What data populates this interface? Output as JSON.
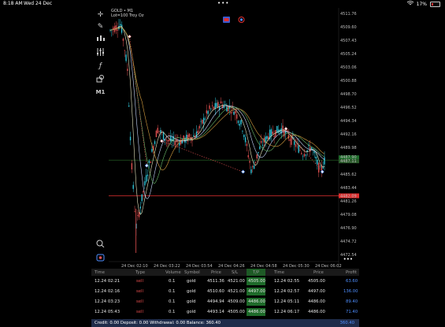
{
  "statusbar": {
    "time": "8:18 AM",
    "date": "Wed 24 Dec",
    "battery": "17%"
  },
  "chart": {
    "symbol": "GOLD • M1",
    "symbol_desc": "Lot=100 Troy Oz",
    "current_bid": "4487.90",
    "current_ask": "4487.11",
    "ref_line_price": "4482.09",
    "price_ticks": [
      "4511.76",
      "4509.60",
      "4507.43",
      "4505.24",
      "4503.06",
      "4500.88",
      "4498.70",
      "4496.52",
      "4494.34",
      "4492.16",
      "4489.98",
      "4487.80",
      "4485.62",
      "4483.44",
      "4481.26",
      "4479.08",
      "4476.90",
      "4474.72",
      "4472.54"
    ],
    "time_ticks": [
      "24 Dec 02:10",
      "24 Dec 03:22",
      "24 Dec 03:54",
      "24 Dec 04:26",
      "24 Dec 04:58",
      "24 Dec 05:30",
      "24 Dec 06:02"
    ],
    "toolbar": [
      "crosshair",
      "draw-pencil",
      "candles",
      "indicators",
      "function",
      "objects",
      "timeframe"
    ],
    "timeframe": "M1"
  },
  "colors": {
    "bull": "#2ec4d8",
    "bear": "#e05050",
    "ref_line": "#e03030",
    "green_line": "#2a6b2a",
    "tp_bg": "#1e6b2a",
    "accent": "#4f8fff"
  },
  "positions": {
    "headers": [
      "Time",
      "Type",
      "Volume",
      "Symbol",
      "Price",
      "S/L",
      "T/P",
      "Time",
      "Price",
      "Profit"
    ],
    "rows": [
      [
        "12.24 02:21",
        "sell",
        "0.1",
        "gold",
        "4511.36",
        "4521.00",
        "4505.00",
        "12.24 02:55",
        "4505.00",
        "63.60"
      ],
      [
        "12.24 02:16",
        "sell",
        "0.1",
        "gold",
        "4510.60",
        "4521.00",
        "4497.00",
        "12.24 02:57",
        "4497.00",
        "136.00"
      ],
      [
        "12.24 03:23",
        "sell",
        "0.1",
        "gold",
        "4494.94",
        "4509.00",
        "4486.00",
        "12.24 05:11",
        "4486.00",
        "89.40"
      ],
      [
        "12.24 05:43",
        "sell",
        "0.1",
        "gold",
        "4493.14",
        "4505.00",
        "4486.00",
        "12.24 06:17",
        "4486.00",
        "71.40"
      ]
    ],
    "footer": "Credit: 0.00 Deposit: 0.00 Withdrawal: 0.00 Balance: 360.40",
    "total": "360.40"
  }
}
